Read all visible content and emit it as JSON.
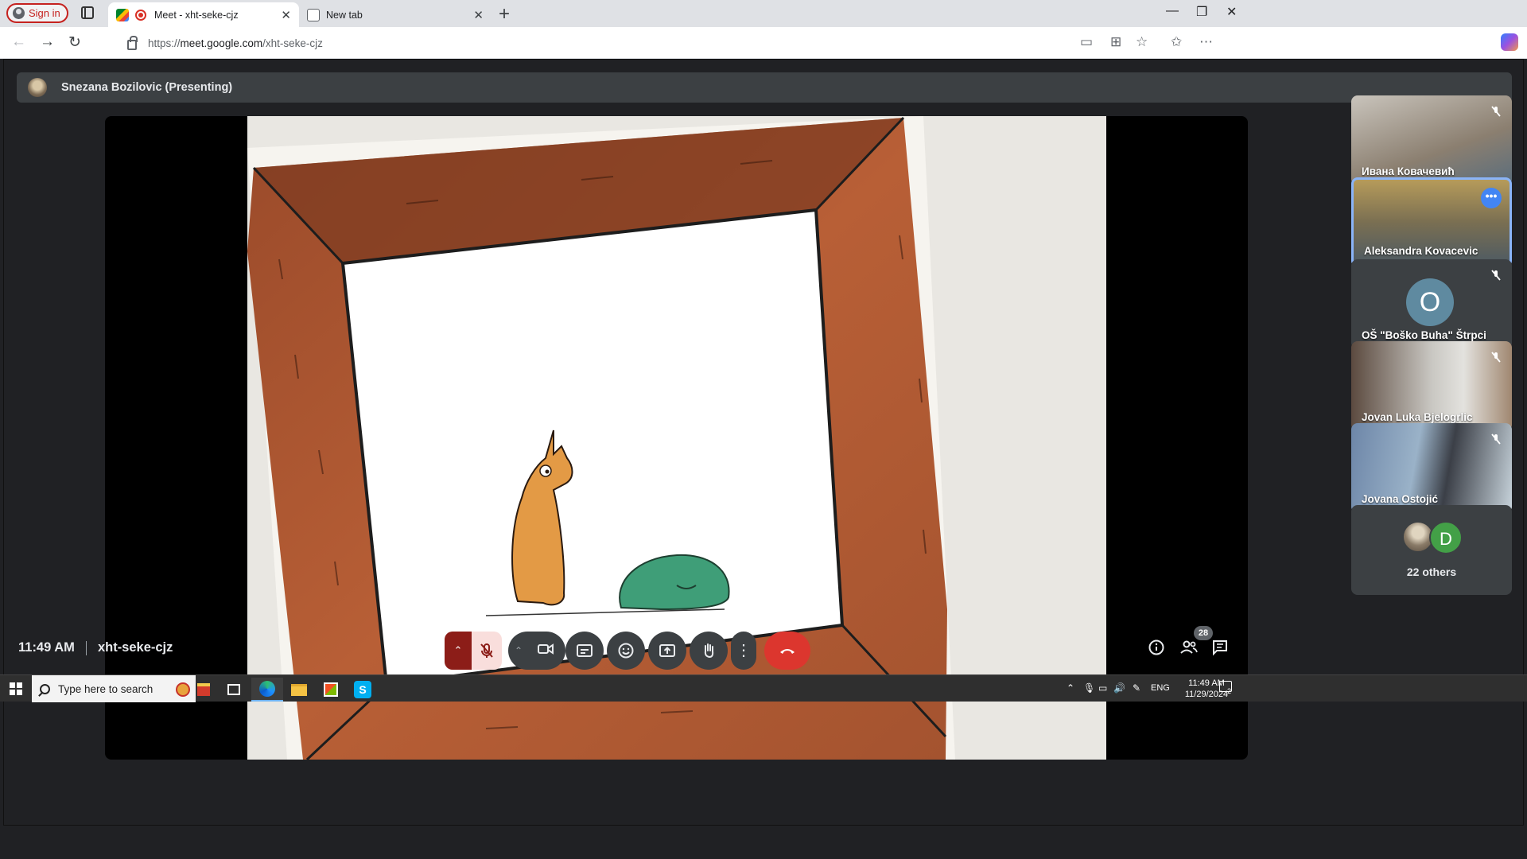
{
  "browser": {
    "signin_label": "Sign in",
    "tabs": [
      {
        "title": "Meet - xht-seke-cjz",
        "active": true
      },
      {
        "title": "New tab",
        "active": false
      }
    ],
    "url_prefix": "https://",
    "url_domain": "meet.google.com",
    "url_path": "/xht-seke-cjz"
  },
  "meet": {
    "presenter_label": "Snezana Bozilovic (Presenting)",
    "time": "11:49 AM",
    "meeting_code": "xht-seke-cjz",
    "people_count": "28",
    "participants": [
      {
        "name": "Ивана Ковачевић",
        "muted": true
      },
      {
        "name": "Aleksandra Kovacevic",
        "speaking": true
      },
      {
        "name": "OŠ \"Boško Buha\" Štrpci",
        "initial": "O",
        "muted": true
      },
      {
        "name": "Jovan Luka Bjelogrlic",
        "muted": true
      },
      {
        "name": "Jovana Ostojić",
        "muted": true
      }
    ],
    "others": {
      "initial": "D",
      "label": "22 others"
    }
  },
  "taskbar": {
    "search_placeholder": "Type here to search",
    "lang": "ENG",
    "time": "11:49 AM",
    "date": "11/29/2024",
    "notifications": "2"
  },
  "colors": {
    "meet_bg": "#202124",
    "end_call": "#dc362e",
    "mic_muted": "#8c1d18",
    "speaking_border": "#8ab4f8"
  }
}
